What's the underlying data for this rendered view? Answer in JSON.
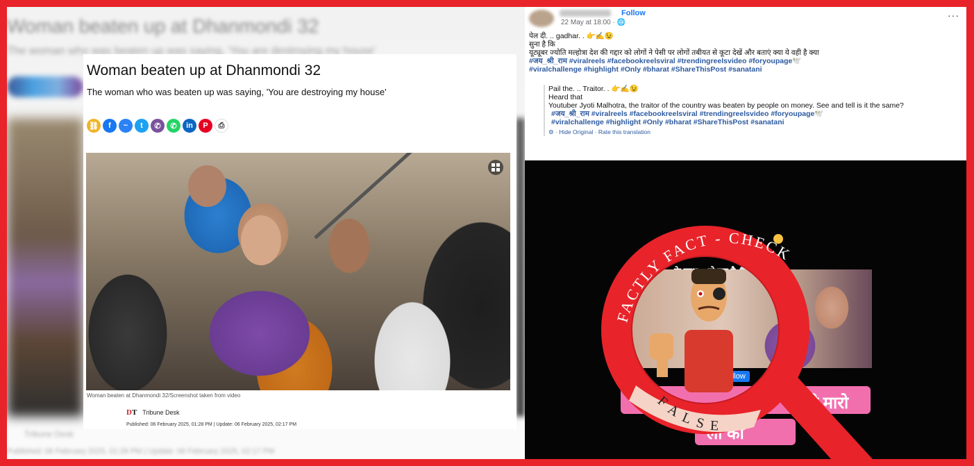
{
  "article": {
    "blurred_title": "Woman beaten up at Dhanmondi 32",
    "blurred_subtitle": "The woman who was beaten up was saying, 'You are destroying my house'",
    "title": "Woman beaten up at Dhanmondi 32",
    "subtitle": "The woman who was beaten up was saying, 'You are destroying my house'",
    "share_icons": [
      {
        "name": "copy-link",
        "glyph": "⛓",
        "color": "#f0b429"
      },
      {
        "name": "facebook",
        "glyph": "f",
        "color": "#1877f2"
      },
      {
        "name": "messenger",
        "glyph": "~",
        "color": "#2a82f6"
      },
      {
        "name": "twitter",
        "glyph": "t",
        "color": "#1da1f2"
      },
      {
        "name": "viber",
        "glyph": "✆",
        "color": "#7b519d"
      },
      {
        "name": "whatsapp",
        "glyph": "✆",
        "color": "#25d366"
      },
      {
        "name": "linkedin",
        "glyph": "in",
        "color": "#0a66c2"
      },
      {
        "name": "pinterest",
        "glyph": "P",
        "color": "#e60023"
      },
      {
        "name": "print",
        "glyph": "⎙",
        "color": "#ffffff",
        "fg": "#333"
      }
    ],
    "photo_caption": "Woman beaten at Dhanmondi 32/Screenshot taken from video",
    "outlet_logo_d": "D",
    "outlet_logo_t": "T",
    "author": "Tribune Desk",
    "published": "Published: 06 February 2025, 01:28 PM  |  Update: 06 February 2025, 02:17 PM",
    "blurred_author": "Tribune Desk",
    "blurred_published": "Published: 06 February 2025, 01:28 PM  |  Update: 06 February 2025, 02:17 PM"
  },
  "facebook_post": {
    "follow_label": "Follow",
    "meta": "22 May at 18:00 · 🌐",
    "more_label": "···",
    "original_line1": "पेल दी. .. gadhar. . 👉✍️😉",
    "original_line2": "सुना है कि",
    "original_line3": "यूट्यूबर ज्योति मल्होत्रा देश की गद्दार को लोगों ने पेसी पर लोगों तबीयत से कूटा देखें और बताएं क्या ये वही है क्या",
    "original_hashtags_1": "#जय_श्री_राम #viralreels #facebookreelsviral #trendingreelsvideo #foryoupage🕊️",
    "original_hashtags_2": "#viralchallenge #highlight #Only #bharat #ShareThisPost #sanatani",
    "translated_line1": "Pail the. .. Traitor. . 👉✍️😉",
    "translated_line2": "Heard that",
    "translated_line3": "Youtuber Jyoti Malhotra, the traitor of the country was beaten by people on money. See and tell is it the same?",
    "translated_hashtags_1": "#जय_श्री_राम #viralreels #facebookreelsviral #trendingreelsvideo #foryoupage🕊️",
    "translated_hashtags_2": "#viralchallenge #highlight #Only #bharat #ShareThisPost #sanatani",
    "translation_links": "⚙ · Hide Original · Rate this translation"
  },
  "video": {
    "overlay_line": "ज्योति म... के साथ... हो रहा है 💀😂",
    "follow_badge": "Follow",
    "pink_text_1": "ोली मारो",
    "pink_text_2": "ली को"
  },
  "stamp": {
    "top_text": "FACTLY FACT - CHECK",
    "verdict": "FALSE",
    "color": "#e8232a"
  },
  "colors": {
    "frame": "#e8232a",
    "facebook_link": "#1877f2",
    "hashtag": "#2c5aa0"
  }
}
